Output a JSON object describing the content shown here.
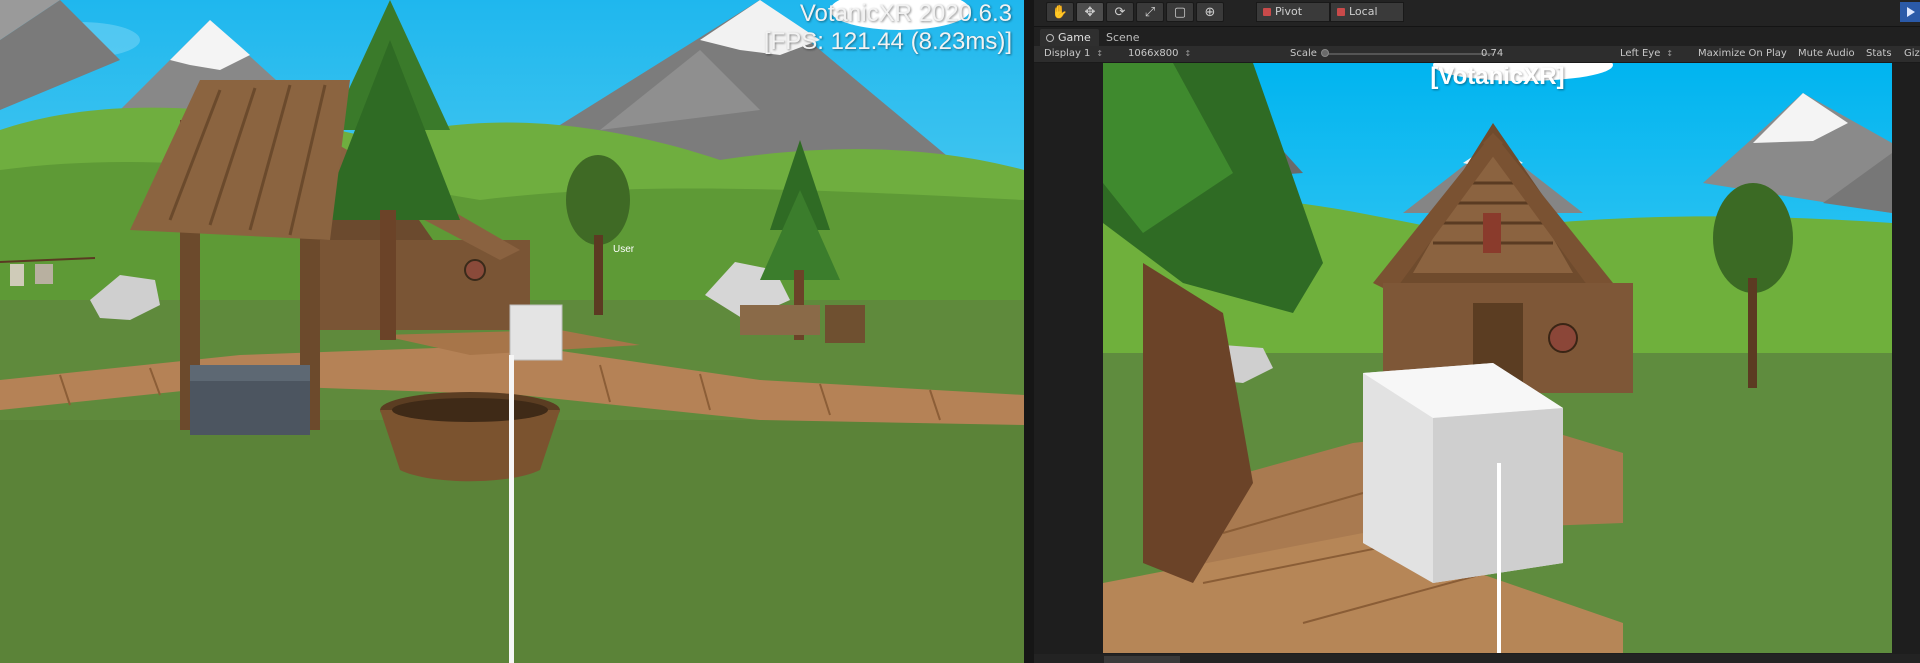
{
  "left_view": {
    "hud_title": "VotanicXR 2020.6.3",
    "hud_fps": "[FPS: 121.44 (8.23ms)]",
    "user_tag": "User"
  },
  "toolbar": {
    "tools": [
      {
        "name": "hand-tool",
        "glyph": "✋"
      },
      {
        "name": "move-tool",
        "glyph": "✥"
      },
      {
        "name": "rotate-tool",
        "glyph": "⟳"
      },
      {
        "name": "scale-tool",
        "glyph": "⤢"
      },
      {
        "name": "rect-tool",
        "glyph": "▢"
      },
      {
        "name": "transform-tool",
        "glyph": "⊕"
      }
    ],
    "pivot_label": "Pivot",
    "local_label": "Local"
  },
  "tabs": {
    "game": "Game",
    "scene": "Scene"
  },
  "game_bar": {
    "display": "Display 1",
    "resolution": "1066x800",
    "scale_label": "Scale",
    "scale_value": "0.74",
    "eye": "Left Eye",
    "maximize": "Maximize On Play",
    "mute": "Mute Audio",
    "stats": "Stats",
    "gizmos": "Gizmos"
  },
  "game_view": {
    "label": "[VotanicXR]"
  },
  "colors": {
    "sky": "#00b4f0",
    "grass": "#5b8a3a",
    "editor_bg": "#282828",
    "play_accent": "#2b5aa8"
  }
}
